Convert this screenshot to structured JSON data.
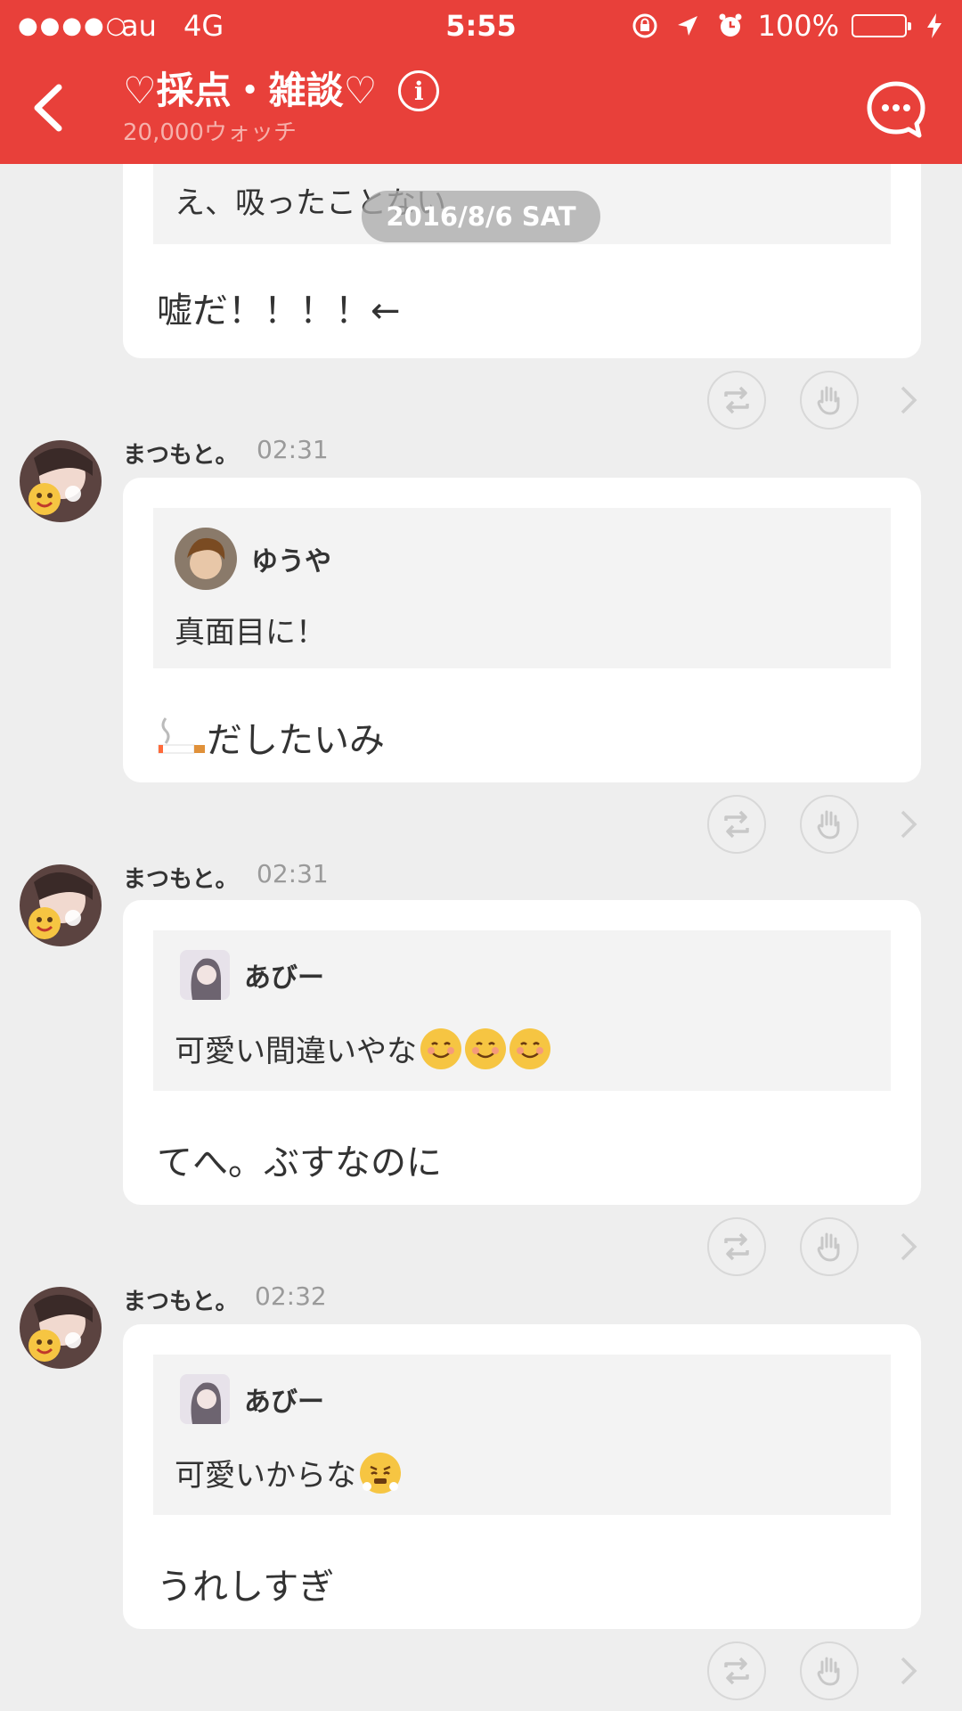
{
  "status_bar": {
    "signal": "●●●●○",
    "carrier": "au",
    "network": "4G",
    "time": "5:55",
    "battery": "100%"
  },
  "header": {
    "title": "♡採点・雑談♡",
    "subtitle": "20,000ウォッチ"
  },
  "date_separator": "2016/8/6 SAT",
  "colors": {
    "accent": "#e8403a",
    "background": "#eeeeee",
    "card": "#ffffff",
    "quote_bg": "#f3f3f3"
  },
  "messages": [
    {
      "quote_text": "え、吸ったことない",
      "text": "嘘だ！！！！←"
    },
    {
      "sender": "まつもと。",
      "time": "02:31",
      "quote_name": "ゆうや",
      "quote_text": "真面目に！",
      "text": "だしたいみ",
      "emoji": "cigarette"
    },
    {
      "sender": "まつもと。",
      "time": "02:31",
      "quote_name": "あびー",
      "quote_text": "可愛い間違いやな",
      "quote_emoji": "smiling-face-x3",
      "text": "てへ。ぶすなのに"
    },
    {
      "sender": "まつもと。",
      "time": "02:32",
      "quote_name": "あびー",
      "quote_text": "可愛いからな",
      "quote_emoji": "face-with-steam",
      "text": "うれしすぎ"
    }
  ]
}
